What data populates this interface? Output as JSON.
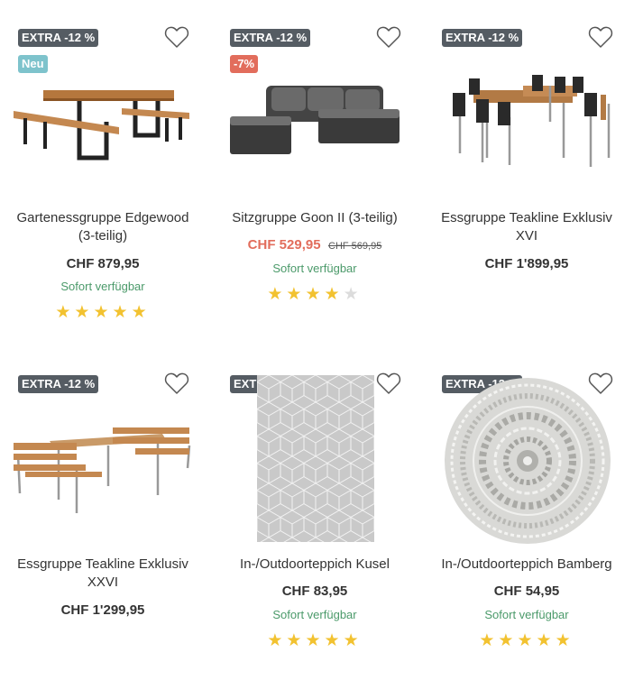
{
  "products": [
    {
      "extra_badge": "EXTRA -12 %",
      "tag": "Neu",
      "name_line1": "Gartenessgruppe Edgewood",
      "name_line2": "(3-teilig)",
      "price": "CHF 879,95",
      "old_price": "",
      "availability": "Sofort verfügbar",
      "rating": 5
    },
    {
      "extra_badge": "EXTRA -12 %",
      "tag": "-7%",
      "name_line1": "Sitzgruppe Goon II (3-teilig)",
      "name_line2": "",
      "price": "CHF 529,95",
      "old_price": "CHF 569,95",
      "availability": "Sofort verfügbar",
      "rating": 4
    },
    {
      "extra_badge": "EXTRA -12 %",
      "tag": "",
      "name_line1": "Essgruppe Teakline Exklusiv",
      "name_line2": "XVI",
      "price": "CHF 1'899,95",
      "old_price": "",
      "availability": "",
      "rating": 0
    },
    {
      "extra_badge": "EXTRA -12 %",
      "tag": "",
      "name_line1": "Essgruppe Teakline Exklusiv",
      "name_line2": "XXVI",
      "price": "CHF 1'299,95",
      "old_price": "",
      "availability": "",
      "rating": 0
    },
    {
      "extra_badge": "EXTRA -12 %",
      "tag": "",
      "name_line1": "In-/Outdoorteppich Kusel",
      "name_line2": "",
      "price": "CHF 83,95",
      "old_price": "",
      "availability": "Sofort verfügbar",
      "rating": 5
    },
    {
      "extra_badge": "EXTRA -12 %",
      "tag": "",
      "name_line1": "In-/Outdoorteppich Bamberg",
      "name_line2": "",
      "price": "CHF 54,95",
      "old_price": "",
      "availability": "Sofort verfügbar",
      "rating": 5
    }
  ],
  "colors": {
    "extra_badge": "#555c63",
    "new_badge": "#7ec3cc",
    "discount_badge": "#e26d5c",
    "sale_price": "#e26d5c",
    "availability": "#4b9a6a",
    "star": "#f2c230"
  },
  "icons": {
    "wishlist": "heart-outline-icon",
    "rating": "star-icon"
  }
}
